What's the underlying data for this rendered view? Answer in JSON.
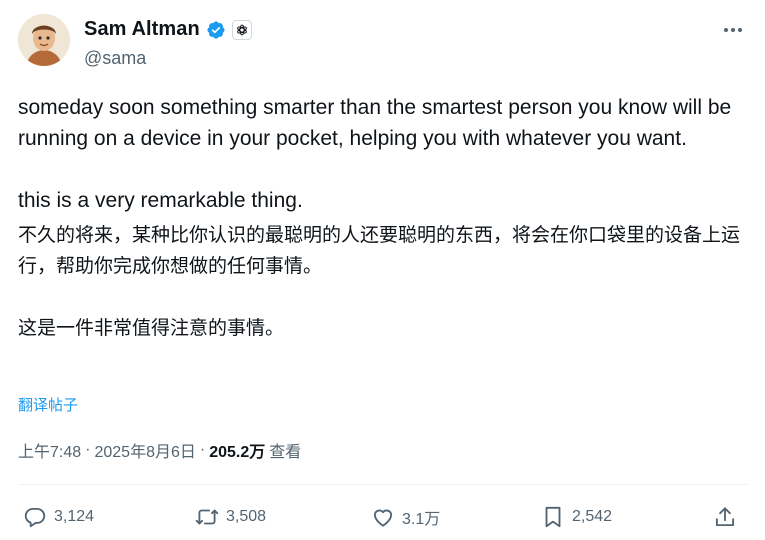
{
  "author": {
    "display_name": "Sam Altman",
    "handle": "@sama",
    "verified_icon": "verified-badge-icon",
    "org_icon": "openai-logo-icon",
    "brand_color": "#1d9bf0"
  },
  "tweet": {
    "en_line1": "someday soon something smarter than the smartest person you know will be running on a device in your pocket, helping you with whatever you want.",
    "en_line2": "this is a very remarkable thing.",
    "zh_line1": "不久的将来，某种比你认识的最聪明的人还要聪明的东西，将会在你口袋里的设备上运行，帮助你完成你想做的任何事情。",
    "zh_line2": "这是一件非常值得注意的事情。",
    "translate_label": "翻译帖子"
  },
  "meta": {
    "time": "上午7:48",
    "separator1": "·",
    "date": "2025年8月6日",
    "separator2": "·",
    "views_count": "205.2万",
    "views_label": "查看"
  },
  "actions": {
    "replies": "3,124",
    "reposts": "3,508",
    "likes": "3.1万",
    "bookmarks": "2,542"
  }
}
